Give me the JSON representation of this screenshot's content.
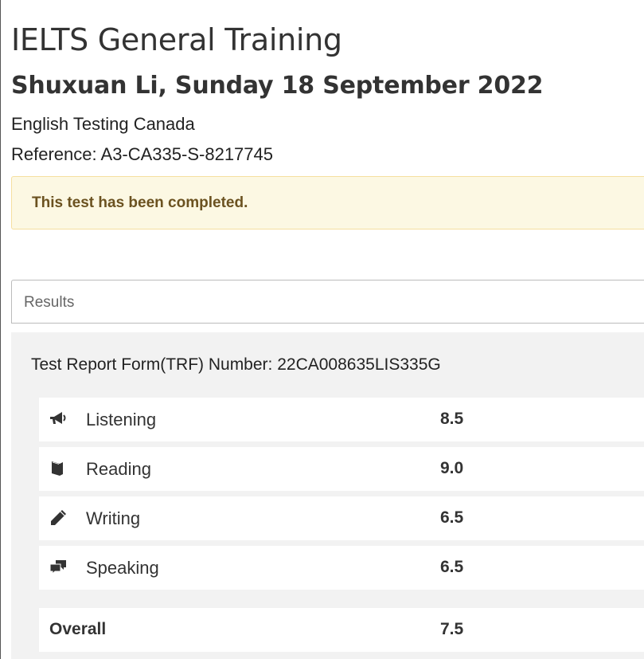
{
  "header": {
    "title": "IELTS General Training",
    "subtitle": "Shuxuan Li, Sunday 18 September 2022",
    "organization": "English Testing Canada",
    "reference": "Reference: A3-CA335-S-8217745"
  },
  "alert": {
    "message": "This test has been completed."
  },
  "results": {
    "panel_label": "Results",
    "trf_number": "Test Report Form(TRF) Number: 22CA008635LIS335G",
    "skills": [
      {
        "label": "Listening",
        "score": "8.5",
        "icon": "megaphone-icon"
      },
      {
        "label": "Reading",
        "score": "9.0",
        "icon": "book-icon"
      },
      {
        "label": "Writing",
        "score": "6.5",
        "icon": "pencil-icon"
      },
      {
        "label": "Speaking",
        "score": "6.5",
        "icon": "chat-bubbles-icon"
      }
    ],
    "overall": {
      "label": "Overall",
      "score": "7.5"
    }
  },
  "colors": {
    "alert_background": "#fcf8e3",
    "alert_text": "#6b5220",
    "panel_background": "#f2f2f2"
  }
}
